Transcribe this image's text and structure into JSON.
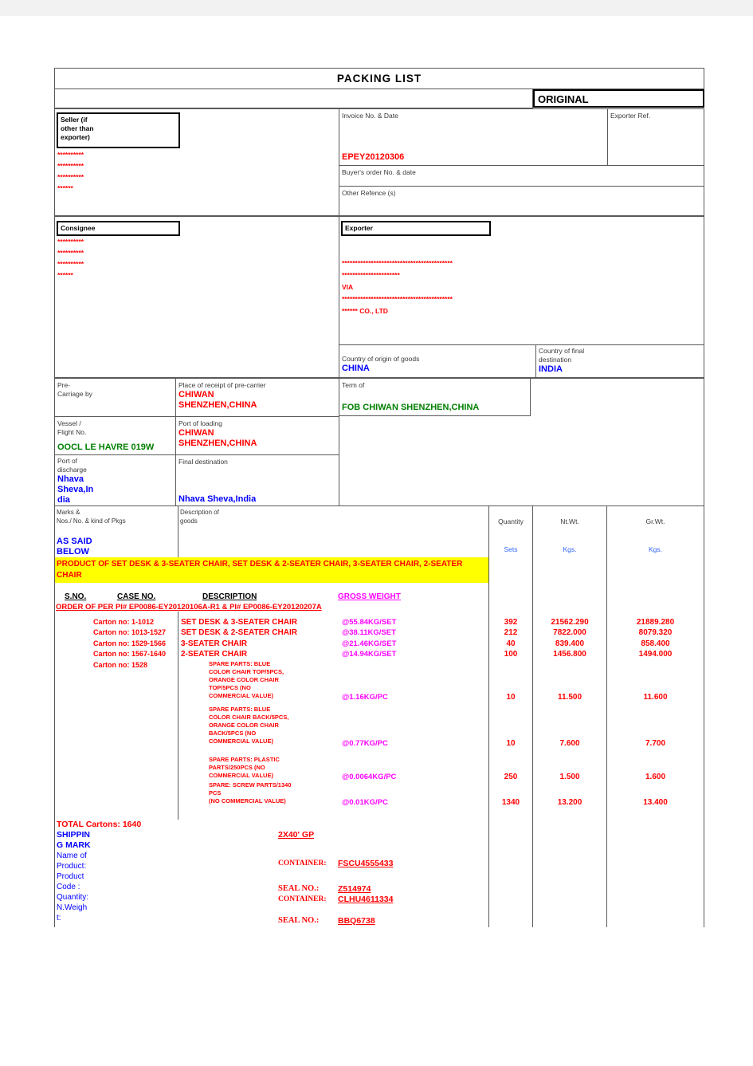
{
  "document": {
    "title": "PACKING  LIST",
    "copy_type": "ORIGINAL"
  },
  "seller": {
    "label": "Seller (if\nother than\nexporter)",
    "lines": [
      "**********",
      "**********",
      "**********",
      "******"
    ]
  },
  "invoice": {
    "label": "Invoice No. & Date",
    "value": "EPEY20120306"
  },
  "exporter_ref": {
    "label": "Exporter Ref.",
    "value": ""
  },
  "buyer_order": {
    "label": "Buyer's order No. & date",
    "value": ""
  },
  "other_reference": {
    "label": "Other Refence (s)",
    "value": ""
  },
  "consignee": {
    "label": "Consignee",
    "lines": [
      "**********",
      "**********",
      "**********",
      "******"
    ]
  },
  "exporter": {
    "label": "Exporter",
    "lines": [
      "******************************************",
      "**********************",
      "VIA",
      "******************************************",
      "****** CO., LTD"
    ]
  },
  "country_origin": {
    "label": "Country of origin of goods",
    "value": "CHINA"
  },
  "country_final": {
    "label": "Country of final\ndestination",
    "value": "INDIA"
  },
  "pre_carriage": {
    "label": "Pre-\nCarriage by",
    "value": ""
  },
  "place_receipt": {
    "label": "Place of receipt of pre-carrier",
    "value": "CHIWAN\nSHENZHEN,CHINA"
  },
  "term": {
    "label": "Term of",
    "value": "FOB CHIWAN SHENZHEN,CHINA"
  },
  "vessel": {
    "label": "Vessel /\nFlight No.",
    "value": "OOCL LE HAVRE 019W"
  },
  "port_loading": {
    "label": "Port of loading",
    "value": "CHIWAN\nSHENZHEN,CHINA"
  },
  "port_discharge": {
    "label": "Port of\ndischarge",
    "value": "Nhava\nSheva,In\ndia"
  },
  "final_destination": {
    "label": "Final destination",
    "value": "Nhava  Sheva,India"
  },
  "goods_table": {
    "headers": {
      "marks": "Marks &\nNos./      No. & kind of Pkgs",
      "description": "Description of\ngoods",
      "quantity": "Quantity",
      "net_weight": "Nt.Wt.",
      "gross_weight": "Gr.Wt."
    },
    "units": {
      "quantity": "Sets",
      "net_weight": "Kgs.",
      "gross_weight": "Kgs."
    },
    "marks_value": "AS SAID\nBELOW",
    "product_banner": "PRODUCT OF SET DESK & 3-SEATER CHAIR, SET DESK & 2-SEATER CHAIR, 3-SEATER CHAIR, 2-SEATER CHAIR",
    "sub_headers": {
      "sno": "S.NO.",
      "case_no": "CASE NO.",
      "description": "DESCRIPTION",
      "gross_weight": "GROSS WEIGHT"
    },
    "order_line": "ORDER OF PER PI# EP0086-EY20120106A-R1 & PI# EP0086-EY20120207A",
    "rows": [
      {
        "case_no": "Carton no: 1-1012",
        "description": "SET DESK & 3-SEATER CHAIR",
        "rate": "@55.84KG/SET",
        "quantity": "392",
        "net_weight": "21562.290",
        "gross_weight": "21889.280"
      },
      {
        "case_no": "Carton no: 1013-1527",
        "description": "SET DESK & 2-SEATER CHAIR",
        "rate": "@38.11KG/SET",
        "quantity": "212",
        "net_weight": "7822.000",
        "gross_weight": "8079.320"
      },
      {
        "case_no": "Carton no: 1529-1566",
        "description": "3-SEATER CHAIR",
        "rate": "@21.46KG/SET",
        "quantity": "40",
        "net_weight": "839.400",
        "gross_weight": "858.400"
      },
      {
        "case_no": "Carton no: 1567-1640",
        "description": "2-SEATER CHAIR",
        "rate": "@14.94KG/SET",
        "quantity": "100",
        "net_weight": "1456.800",
        "gross_weight": "1494.000"
      }
    ],
    "spare_case_no": "Carton no: 1528",
    "spare_rows": [
      {
        "description": "SPARE PARTS: BLUE\nCOLOR CHAIR TOP/5PCS,\nORANGE COLOR CHAIR\nTOP/5PCS (NO\nCOMMERCIAL VALUE)",
        "rate": "@1.16KG/PC",
        "quantity": "10",
        "net_weight": "11.500",
        "gross_weight": "11.600"
      },
      {
        "description": "SPARE PARTS:  BLUE\nCOLOR CHAIR BACK/5PCS,\nORANGE COLOR CHAIR\nBACK/5PCS (NO\nCOMMERCIAL VALUE)",
        "rate": "@0.77KG/PC",
        "quantity": "10",
        "net_weight": "7.600",
        "gross_weight": "7.700"
      },
      {
        "description": "SPARE PARTS: PLASTIC\nPARTS/250PCS (NO\nCOMMERCIAL VALUE)",
        "rate": "@0.0064KG/PC",
        "quantity": "250",
        "net_weight": "1.500",
        "gross_weight": "1.600"
      },
      {
        "description": "SPARE: SCREW PARTS/1340\nPCS\n(NO COMMERCIAL VALUE)",
        "rate": "@0.01KG/PC",
        "quantity": "1340",
        "net_weight": "13.200",
        "gross_weight": "13.400"
      }
    ]
  },
  "footer": {
    "total_cartons": "TOTAL   Cartons:  1640",
    "shipping_mark_label": "SHIPPIN\nG MARK",
    "fields": [
      "Name of\nProduct:",
      "Product\nCode :",
      "Quantity:",
      "N.Weigh\nt:"
    ],
    "container_info": {
      "size": "2X40' GP",
      "entries": [
        {
          "label": "CONTAINER:",
          "value": "FSCU4555433"
        },
        {
          "label": "SEAL NO.:",
          "value": "Z514974"
        },
        {
          "label": "CONTAINER:",
          "value": "CLHU4611334"
        },
        {
          "label": "SEAL NO.:",
          "value": "BBQ6738"
        }
      ]
    }
  }
}
